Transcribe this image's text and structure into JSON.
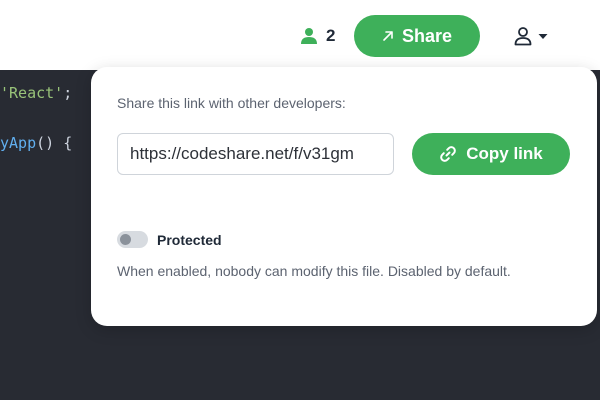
{
  "header": {
    "user_count": "2",
    "share_label": "Share",
    "icons": {
      "users": "user-icon",
      "share": "arrow-up-right-icon",
      "account": "account-icon",
      "account_menu": "caret-down-icon"
    }
  },
  "editor": {
    "line1": {
      "string": "'React'",
      "punct": ";"
    },
    "line2": {
      "fn": "yApp",
      "punct": "() {"
    }
  },
  "share_popover": {
    "hint": "Share this link with other developers:",
    "link_value": "https://codeshare.net/f/v31gm",
    "copy_label": "Copy link",
    "copy_icon": "link-icon",
    "protected_label": "Protected",
    "protected_enabled": false,
    "protected_description": "When enabled, nobody can modify this file. Disabled by default."
  },
  "colors": {
    "accent": "#3eb05a",
    "editor_bg": "#282b33",
    "string": "#98c379",
    "function": "#61afef"
  }
}
